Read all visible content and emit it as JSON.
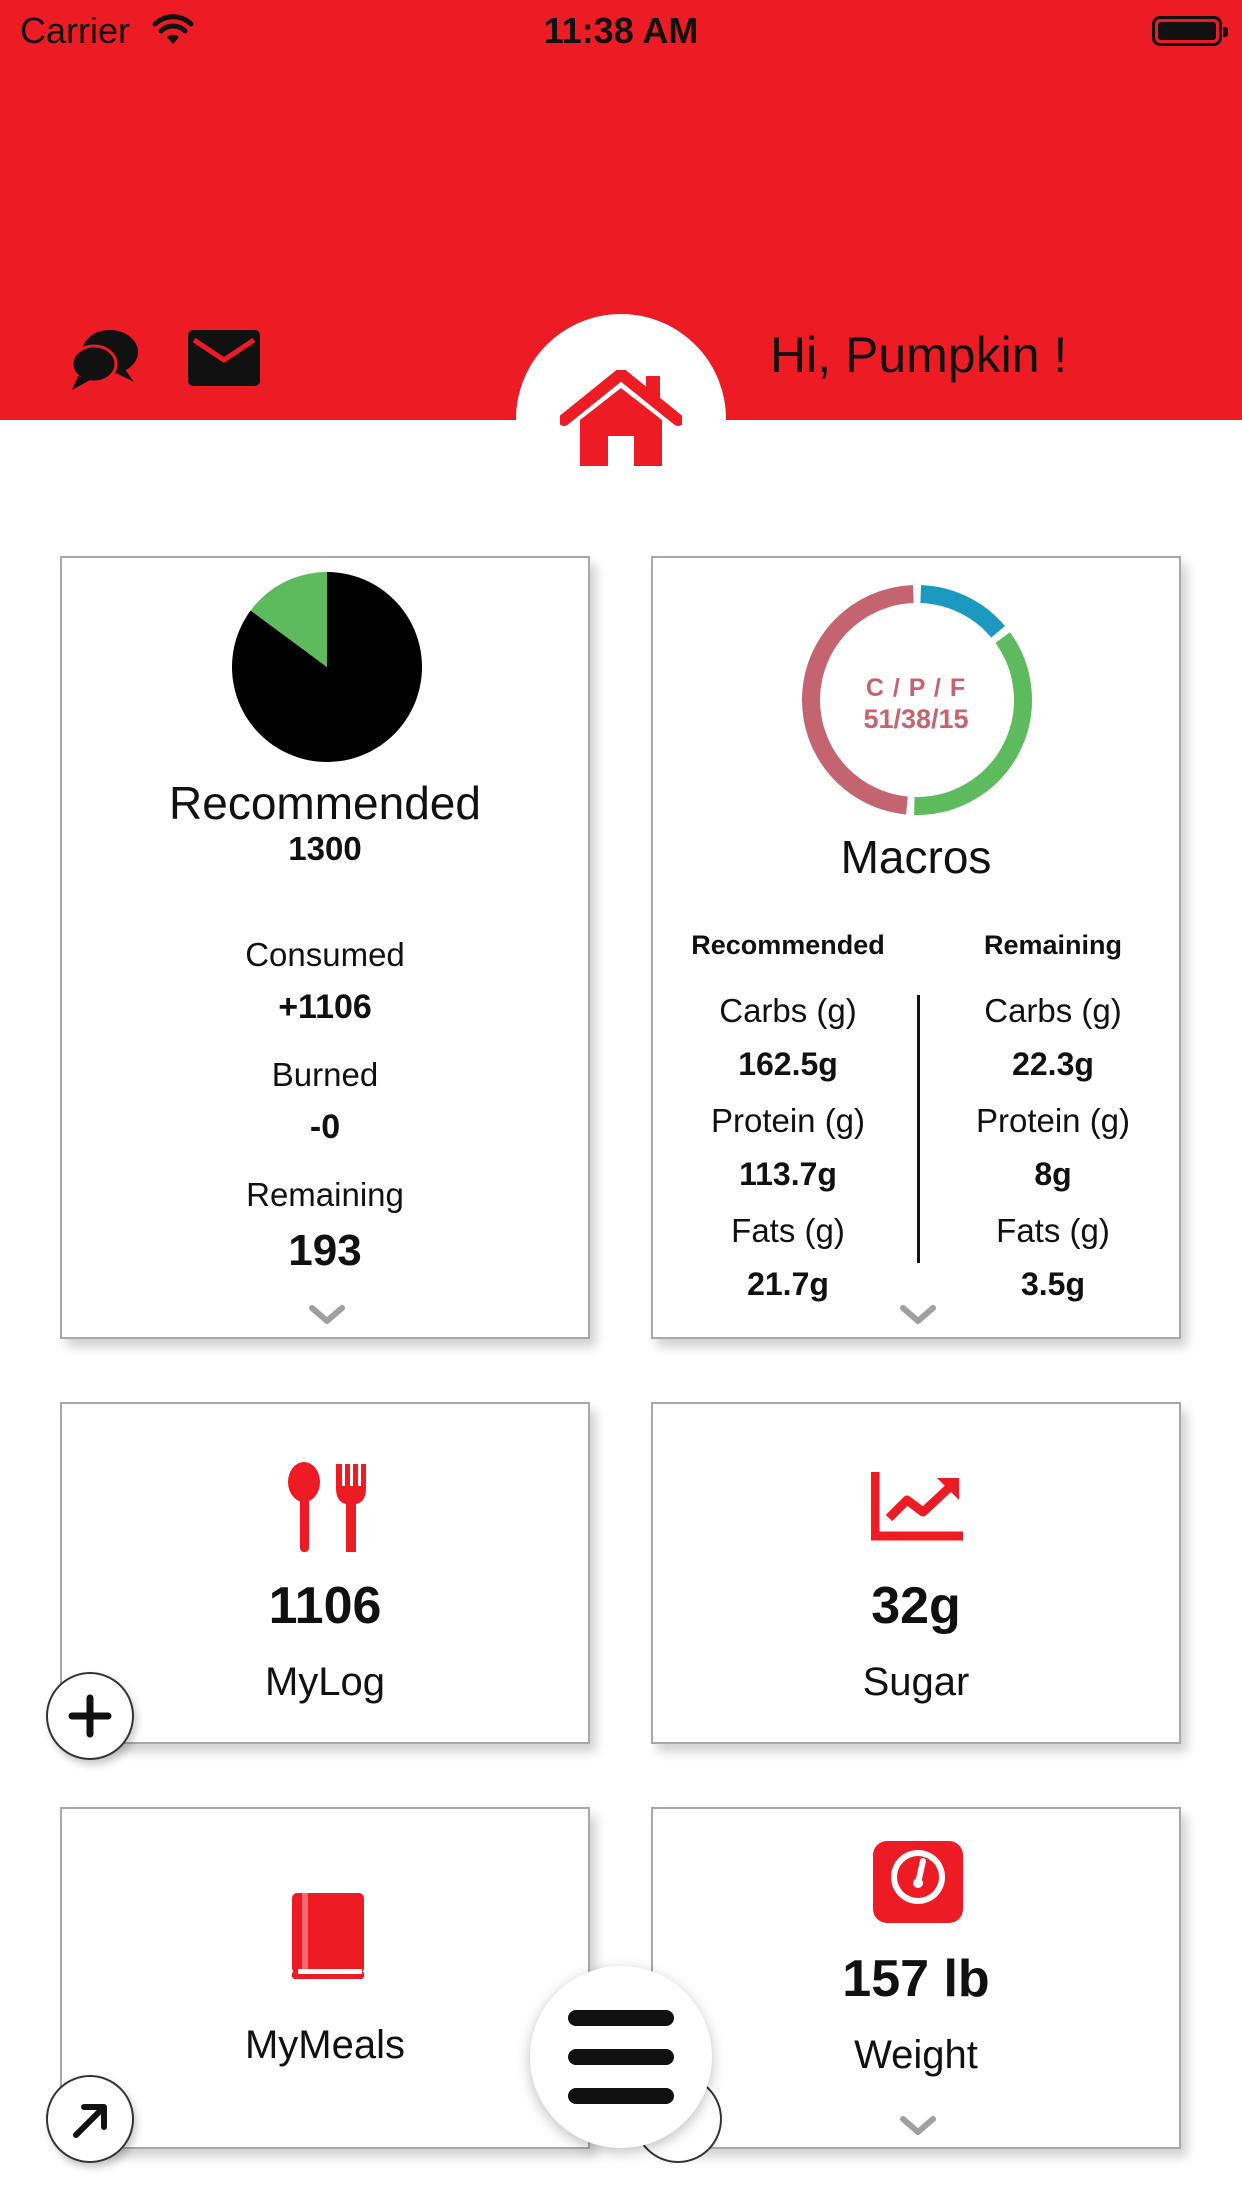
{
  "status_bar": {
    "carrier": "Carrier",
    "time": "11:38 AM"
  },
  "header": {
    "greeting": "Hi, Pumpkin !"
  },
  "calories": {
    "title": "Recommended",
    "recommended": "1300",
    "consumed_label": "Consumed",
    "consumed": "+1106",
    "burned_label": "Burned",
    "burned": "-0",
    "remaining_label": "Remaining",
    "remaining": "193"
  },
  "macros": {
    "title": "Macros",
    "ring_label": "C / P / F",
    "ring_values": "51/38/15",
    "recommended_header": "Recommended",
    "remaining_header": "Remaining",
    "carbs_label": "Carbs (g)",
    "protein_label": "Protein (g)",
    "fats_label": "Fats (g)",
    "rec_carbs": "162.5g",
    "rec_protein": "113.7g",
    "rec_fats": "21.7g",
    "rem_carbs": "22.3g",
    "rem_protein": "8g",
    "rem_fats": "3.5g"
  },
  "mylog": {
    "value": "1106",
    "label": "MyLog"
  },
  "sugar": {
    "value": "32g",
    "label": "Sugar"
  },
  "mymeals": {
    "label": "MyMeals"
  },
  "weight": {
    "value": "157 lb",
    "label": "Weight"
  },
  "chart_data": [
    {
      "type": "pie",
      "title": "",
      "categories": [
        "consumed",
        "remaining"
      ],
      "values": [
        1106,
        193
      ],
      "colors": [
        "#000000",
        "#5DBB5D"
      ]
    },
    {
      "type": "pie",
      "title": "",
      "categories": [
        "C",
        "P",
        "F"
      ],
      "values": [
        51,
        38,
        15
      ],
      "colors": [
        "#C46470",
        "#5DBB5D",
        "#1B99C1"
      ]
    }
  ],
  "colors": {
    "brand_red": "#ED1C24",
    "green": "#5DBB5D",
    "carb_pink": "#C46470",
    "fat_blue": "#1B99C1"
  },
  "icons": [
    "wifi-icon",
    "battery-icon",
    "chat-icon",
    "mail-icon",
    "home-icon",
    "chevron-down-icon",
    "utensils-icon",
    "chart-line-icon",
    "book-icon",
    "scale-icon",
    "plus-icon",
    "arrow-up-right-icon",
    "menu-icon"
  ]
}
